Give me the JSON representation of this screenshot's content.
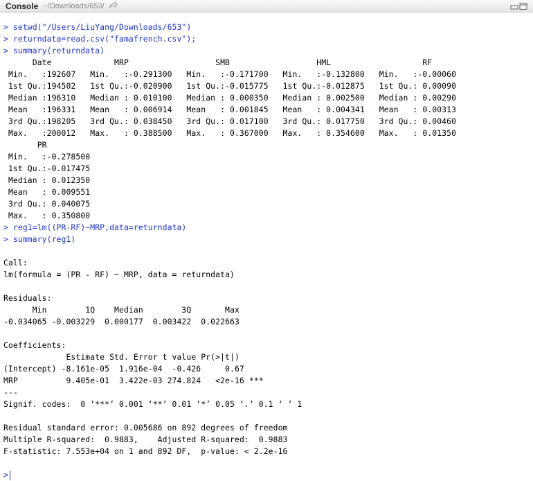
{
  "header": {
    "title": "Console",
    "path": "~/Downloads/653/",
    "goto_icon": "arrow-goto-icon",
    "controls": [
      "minimize-icon",
      "maximize-icon"
    ]
  },
  "console": {
    "lines": [
      {
        "kind": "cmd",
        "text": "> setwd(\"/Users/LiuYang/Downloads/653\")"
      },
      {
        "kind": "cmd",
        "text": "> returndata=read.csv(\"famafrench.csv\");"
      },
      {
        "kind": "cmd",
        "text": "> summary(returndata)"
      },
      {
        "kind": "out",
        "text": "      Date             MRP                  SMB                  HML                   RF         "
      },
      {
        "kind": "out",
        "text": " Min.   :192607   Min.   :-0.291300   Min.   :-0.171700   Min.   :-0.132800   Min.   :-0.00060  "
      },
      {
        "kind": "out",
        "text": " 1st Qu.:194502   1st Qu.:-0.020900   1st Qu.:-0.015775   1st Qu.:-0.012875   1st Qu.: 0.00090  "
      },
      {
        "kind": "out",
        "text": " Median :196310   Median : 0.010100   Median : 0.000350   Median : 0.002500   Median : 0.00290  "
      },
      {
        "kind": "out",
        "text": " Mean   :196331   Mean   : 0.006914   Mean   : 0.001845   Mean   : 0.004341   Mean   : 0.00313  "
      },
      {
        "kind": "out",
        "text": " 3rd Qu.:198205   3rd Qu.: 0.038450   3rd Qu.: 0.017100   3rd Qu.: 0.017750   3rd Qu.: 0.00460  "
      },
      {
        "kind": "out",
        "text": " Max.   :200012   Max.   : 0.388500   Max.   : 0.367000   Max.   : 0.354600   Max.   : 0.01350  "
      },
      {
        "kind": "out",
        "text": "       PR           "
      },
      {
        "kind": "out",
        "text": " Min.   :-0.278500  "
      },
      {
        "kind": "out",
        "text": " 1st Qu.:-0.017475  "
      },
      {
        "kind": "out",
        "text": " Median : 0.012350  "
      },
      {
        "kind": "out",
        "text": " Mean   : 0.009551  "
      },
      {
        "kind": "out",
        "text": " 3rd Qu.: 0.040075  "
      },
      {
        "kind": "out",
        "text": " Max.   : 0.350800  "
      },
      {
        "kind": "cmd",
        "text": "> reg1=lm((PR-RF)~MRP,data=returndata)"
      },
      {
        "kind": "cmd",
        "text": "> summary(reg1)"
      },
      {
        "kind": "out",
        "text": ""
      },
      {
        "kind": "out",
        "text": "Call:"
      },
      {
        "kind": "out",
        "text": "lm(formula = (PR - RF) ~ MRP, data = returndata)"
      },
      {
        "kind": "out",
        "text": ""
      },
      {
        "kind": "out",
        "text": "Residuals:"
      },
      {
        "kind": "out",
        "text": "      Min        1Q    Median        3Q       Max "
      },
      {
        "kind": "out",
        "text": "-0.034065 -0.003229  0.000177  0.003422  0.022663 "
      },
      {
        "kind": "out",
        "text": ""
      },
      {
        "kind": "out",
        "text": "Coefficients:"
      },
      {
        "kind": "out",
        "text": "             Estimate Std. Error t value Pr(>|t|)    "
      },
      {
        "kind": "out",
        "text": "(Intercept) -8.161e-05  1.916e-04  -0.426     0.67    "
      },
      {
        "kind": "out",
        "text": "MRP          9.405e-01  3.422e-03 274.824   <2e-16 ***"
      },
      {
        "kind": "out",
        "text": "---"
      },
      {
        "kind": "out",
        "text": "Signif. codes:  0 ‘***’ 0.001 ‘**’ 0.01 ‘*’ 0.05 ‘.’ 0.1 ‘ ’ 1"
      },
      {
        "kind": "out",
        "text": ""
      },
      {
        "kind": "out",
        "text": "Residual standard error: 0.005686 on 892 degrees of freedom"
      },
      {
        "kind": "out",
        "text": "Multiple R-squared:  0.9883,\tAdjusted R-squared:  0.9883 "
      },
      {
        "kind": "out",
        "text": "F-statistic: 7.553e+04 on 1 and 892 DF,  p-value: < 2.2e-16"
      },
      {
        "kind": "out",
        "text": ""
      }
    ],
    "prompt": ">"
  },
  "colors": {
    "command": "#1d34d6",
    "output": "#000000",
    "header_path": "#8a8a8a"
  }
}
